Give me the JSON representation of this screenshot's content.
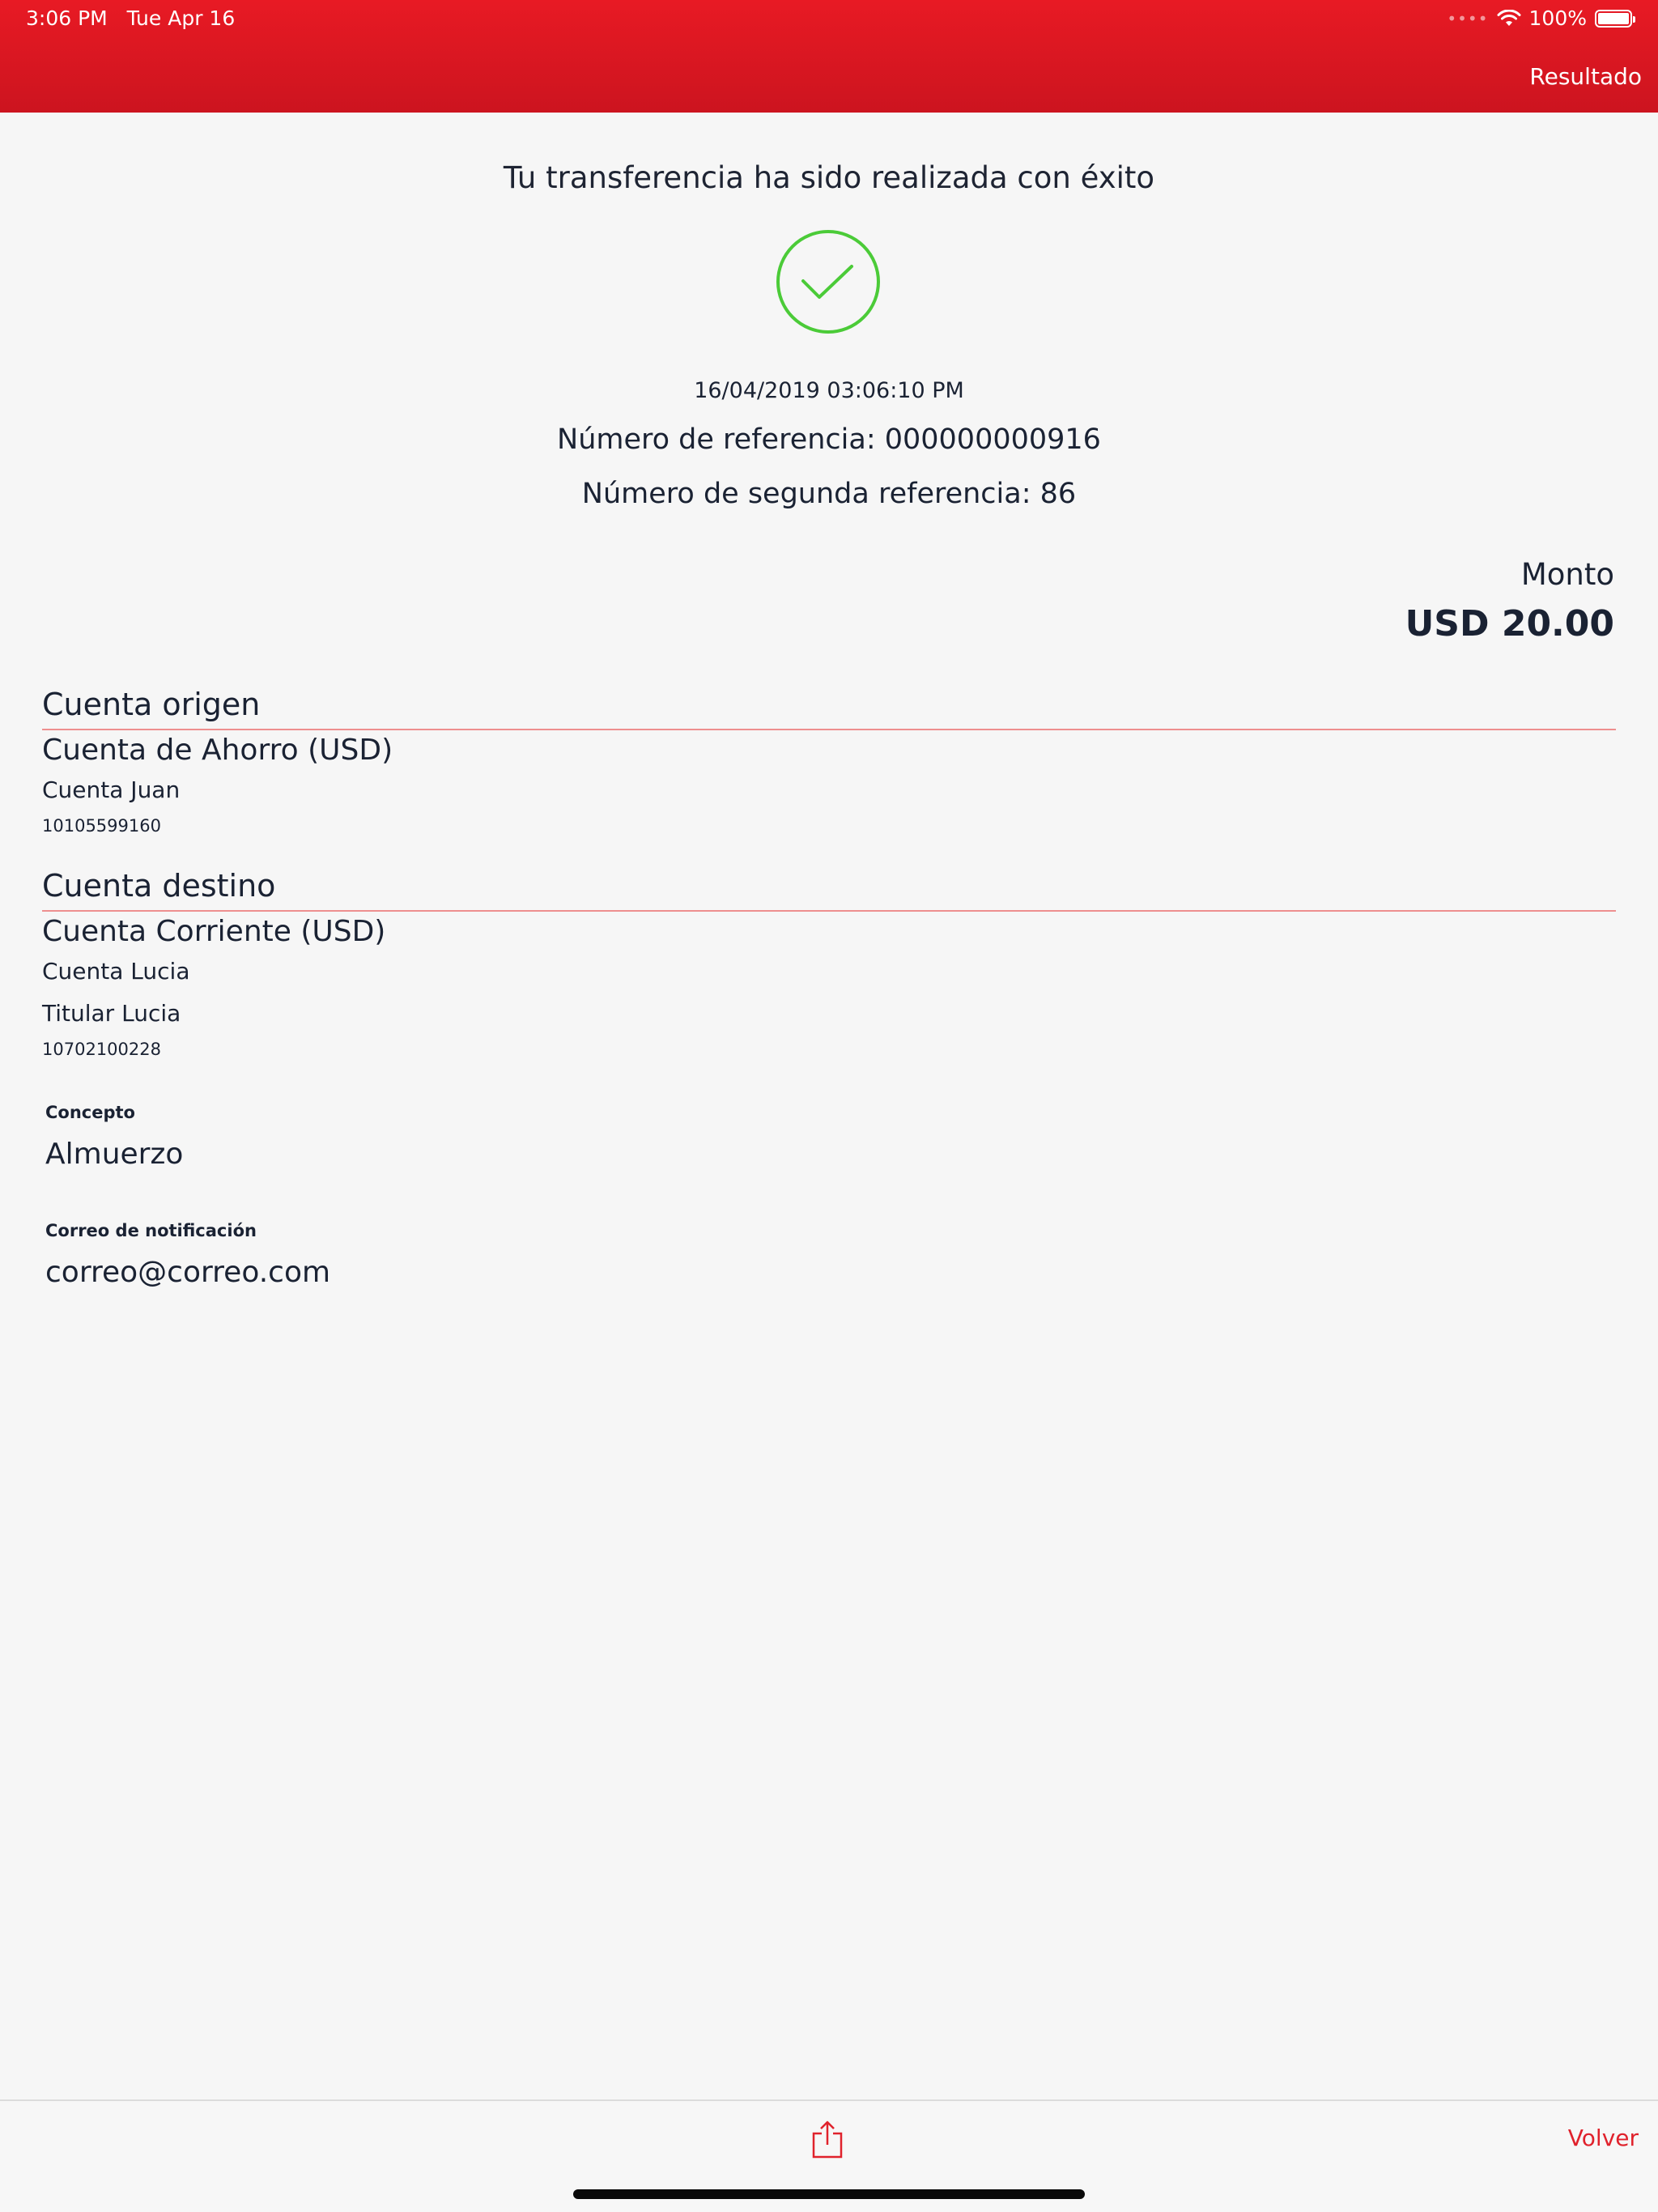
{
  "status_bar": {
    "time": "3:06 PM",
    "date": "Tue Apr 16",
    "signal": "••••",
    "battery": "100%",
    "wifi_icon": "wifi-icon",
    "battery_icon": "battery-icon"
  },
  "header": {
    "title": "Resultado",
    "color": "#e0141f"
  },
  "result": {
    "message": "Tu transferencia ha sido realizada con éxito",
    "icon": "success-check-icon",
    "icon_color": "#4bcb38",
    "datetime": "16/04/2019 03:06:10 PM",
    "reference": "Número de referencia: 000000000916",
    "second_reference": "Número de segunda referencia: 86"
  },
  "amount": {
    "label": "Monto",
    "value": "USD 20.00"
  },
  "origin": {
    "title": "Cuenta origen",
    "account_type": "Cuenta de Ahorro (USD)",
    "account_name": "Cuenta Juan",
    "account_number": "10105599160"
  },
  "destination": {
    "title": "Cuenta destino",
    "account_type": "Cuenta Corriente (USD)",
    "account_name": "Cuenta Lucia",
    "holder": "Titular Lucia",
    "account_number": "10702100228"
  },
  "concept": {
    "label": "Concepto",
    "value": "Almuerzo"
  },
  "notification": {
    "label": "Correo de notificación",
    "value": "correo@correo.com"
  },
  "bottom_bar": {
    "share_icon": "share-icon",
    "back_label": "Volver"
  }
}
